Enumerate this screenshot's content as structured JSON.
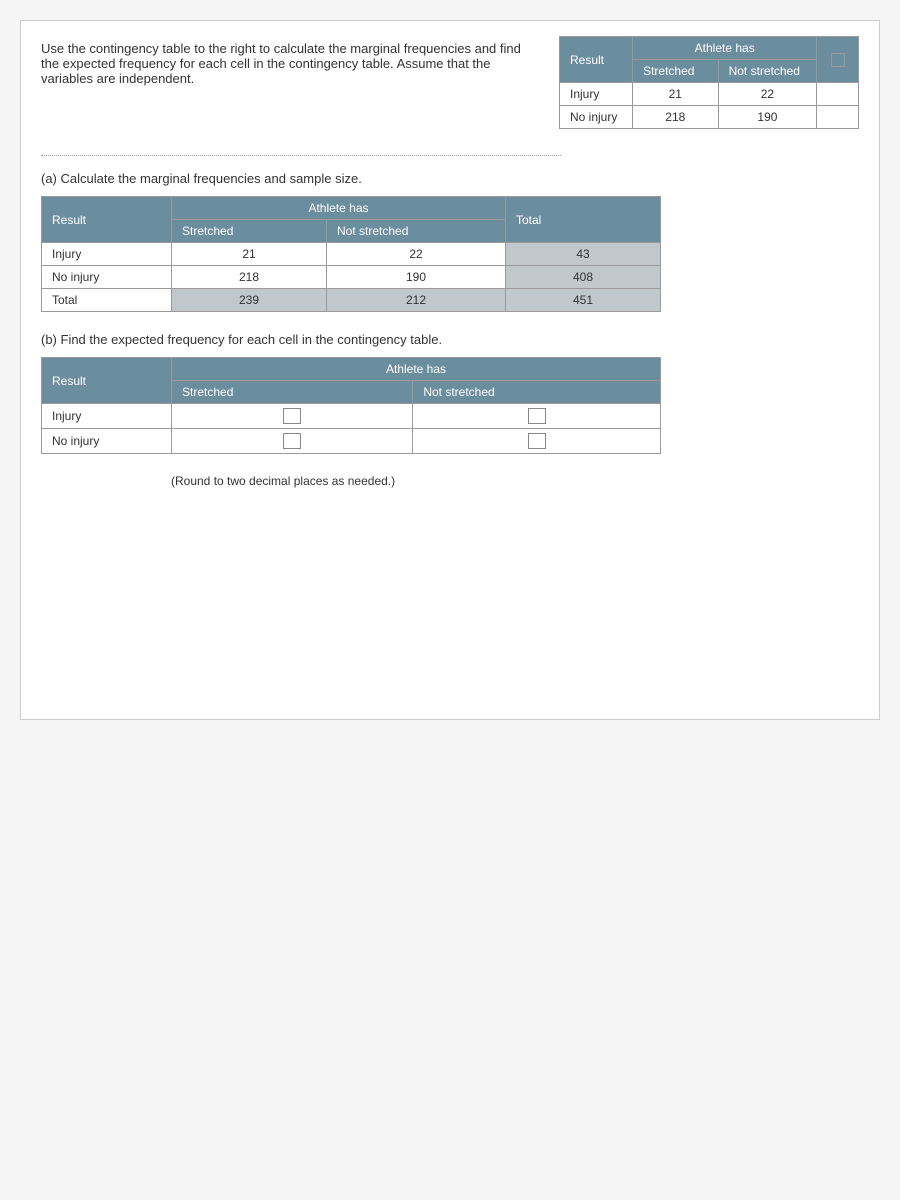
{
  "intro": "Use the contingency table to the right to calculate the marginal frequencies and find the expected frequency for each cell in the contingency table. Assume that the variables are independent.",
  "right_table": {
    "header": {
      "athlete": "Athlete has",
      "result": "Result",
      "stretched": "Stretched",
      "not_stretched": "Not stretched"
    },
    "rows": {
      "injury": {
        "label": "Injury",
        "stretched": "21",
        "not_stretched": "22"
      },
      "no_injury": {
        "label": "No injury",
        "stretched": "218",
        "not_stretched": "190"
      }
    }
  },
  "part_a": {
    "label": "(a) Calculate the marginal frequencies and sample size.",
    "header": {
      "athlete": "Athlete has",
      "result": "Result",
      "stretched": "Stretched",
      "not_stretched": "Not stretched",
      "total": "Total"
    },
    "rows": {
      "injury": {
        "label": "Injury",
        "stretched": "21",
        "not_stretched": "22",
        "total": "43"
      },
      "no_injury": {
        "label": "No injury",
        "stretched": "218",
        "not_stretched": "190",
        "total": "408"
      },
      "total": {
        "label": "Total",
        "stretched": "239",
        "not_stretched": "212",
        "total": "451"
      }
    }
  },
  "part_b": {
    "label": "(b) Find the expected frequency for each cell in the contingency table.",
    "header": {
      "athlete": "Athlete has",
      "result": "Result",
      "stretched": "Stretched",
      "not_stretched": "Not stretched"
    },
    "rows": {
      "injury": {
        "label": "Injury"
      },
      "no_injury": {
        "label": "No injury"
      }
    },
    "note": "(Round to two decimal places as needed.)"
  }
}
